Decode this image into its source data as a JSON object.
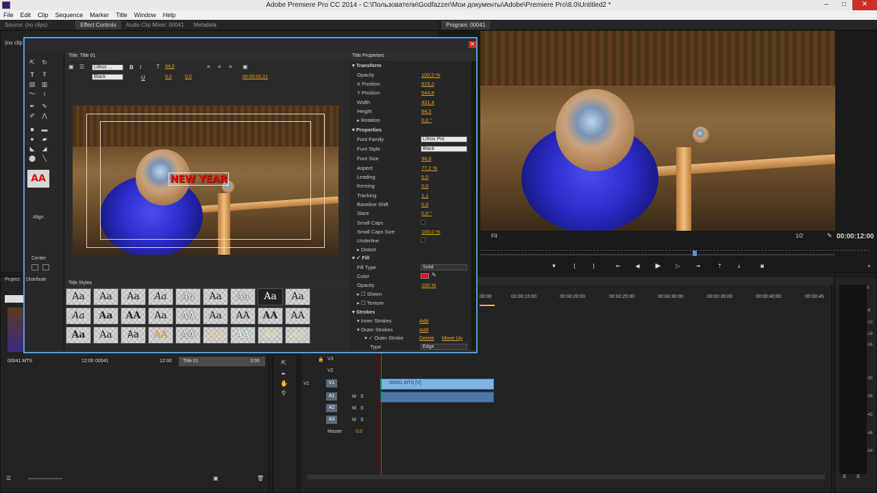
{
  "window": {
    "title": "Adobe Premiere Pro CC 2014 - C:\\Пользователи\\Godfazzer\\Мои документы\\Adobe\\Premiere Pro\\8.0\\Untitled2 *",
    "minimize": "–",
    "maximize": "□",
    "close": "✕"
  },
  "menu": [
    "File",
    "Edit",
    "Clip",
    "Sequence",
    "Marker",
    "Title",
    "Window",
    "Help"
  ],
  "source_tabs": {
    "source": "Source: (no clips)",
    "effect_controls": "Effect Controls",
    "audio_mixer": "Audio Clip Mixer: 00041",
    "metadata": "Metadata",
    "no_clip": "(no clip"
  },
  "program": {
    "tab": "Program: 00041",
    "timecode": "00:00:12:00",
    "fit": "Fit",
    "resolution": "1/2"
  },
  "title_window": {
    "tab": "Title: Title 01",
    "font": "Lithos ...",
    "style": "Black",
    "size": "94,0",
    "kerning": "0,0",
    "leading": "0,0",
    "timecode": "00:00:00:21",
    "canvas_text": "NEW YEAR",
    "styles_tab": "Title Styles",
    "style_samples": [
      "Aa",
      "Aa",
      "Aa",
      "Aa",
      "Aa",
      "Aa",
      "Aa",
      "Aa",
      "Aa",
      "Aa",
      "Aa",
      "AA",
      "Aa",
      "AA",
      "Aa",
      "AA",
      "AA",
      "AA",
      "Aa",
      "Aa",
      "Aa",
      "AA",
      "AA",
      "AA",
      "AA",
      "Aa",
      "Aa"
    ],
    "align": "Align",
    "center": "Center",
    "distribute": "Distribute"
  },
  "title_properties": {
    "tab": "Title Properties",
    "transform": "Transform",
    "opacity_label": "Opacity",
    "opacity": "100,0 %",
    "xpos_label": "X Position",
    "xpos": "915,2",
    "ypos_label": "Y Position",
    "ypos": "544,8",
    "width_label": "Width",
    "width": "431,4",
    "height_label": "Height",
    "height": "94,0",
    "rotation_label": "Rotation",
    "rotation": "0,0 °",
    "properties": "Properties",
    "font_family_label": "Font Family",
    "font_family": "Lithos Pro",
    "font_style_label": "Font Style",
    "font_style": "Black",
    "font_size_label": "Font Size",
    "font_size": "94,0",
    "aspect_label": "Aspect",
    "aspect": "77,2 %",
    "leading_label": "Leading",
    "leading": "0,0",
    "kerning_label": "Kerning",
    "kerning": "0,0",
    "tracking_label": "Tracking",
    "tracking": "1,1",
    "baseline_label": "Baseline Shift",
    "baseline": "0,0",
    "slant_label": "Slant",
    "slant": "0,0 °",
    "small_caps_label": "Small Caps",
    "small_caps_size_label": "Small Caps Size",
    "small_caps_size": "100,0 %",
    "underline_label": "Underline",
    "distort_label": "Distort",
    "fill": "Fill",
    "fill_type_label": "Fill Type",
    "fill_type": "Solid",
    "color_label": "Color",
    "fill_opacity_label": "Opacity",
    "fill_opacity": "100 %",
    "sheen_label": "Sheen",
    "texture_label": "Texture",
    "strokes": "Strokes",
    "inner_strokes_label": "Inner Strokes",
    "add": "Add",
    "outer_strokes_label": "Outer Strokes",
    "outer_stroke_label": "Outer Stroke",
    "delete": "Delete",
    "move_up": "Move Up",
    "type_label": "Type",
    "type": "Edge",
    "fill_color": "#e01010"
  },
  "project": {
    "tab": "Project",
    "col_name": "00041.MTS",
    "col_dur": "12:00",
    "item2": "00041",
    "item2_dur": "12:00",
    "item3": "Title 01",
    "item3_dur": "3:00"
  },
  "timeline": {
    "ruler": [
      "00:00",
      "00:00:15:00",
      "00:00:20:00",
      "00:00:25:00",
      "00:00:30:00",
      "00:00:35:00",
      "00:00:40:00",
      "00:00:45"
    ],
    "tracks": [
      "V3",
      "V2",
      "V1",
      "A1",
      "A2",
      "A3"
    ],
    "source_v1": "V1",
    "master": "Master",
    "master_val": "0,0",
    "clip_v1": "00041.MTS [V]",
    "m": "M",
    "s": "S"
  },
  "meter": {
    "levels": [
      "0",
      "-6",
      "-12",
      "-18",
      "-24",
      "-30",
      "-36",
      "-42",
      "-48",
      "-54"
    ],
    "s": "S"
  }
}
